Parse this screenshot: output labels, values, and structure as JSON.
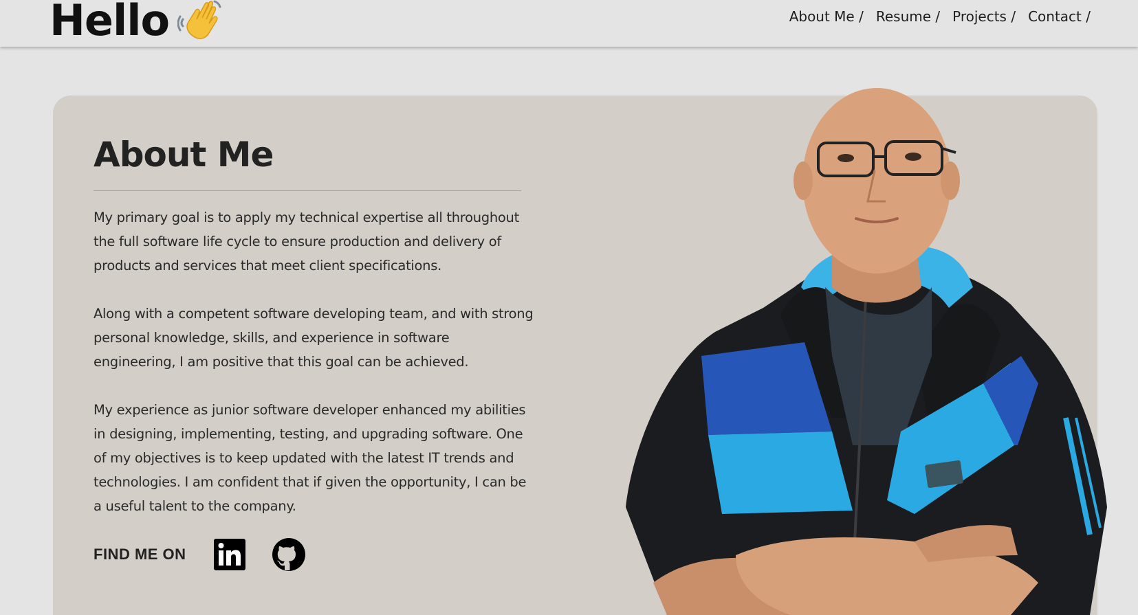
{
  "header": {
    "brand": "Hello",
    "wave_icon": "waving-hand-icon",
    "nav": [
      {
        "label": "About Me /"
      },
      {
        "label": "Resume /"
      },
      {
        "label": "Projects /"
      },
      {
        "label": "Contact /"
      }
    ]
  },
  "about": {
    "title": "About Me",
    "paragraphs": [
      "My primary goal is to apply my technical expertise all throughout the full software life cycle to ensure production and delivery of products and services that meet client specifications.",
      "Along with a competent software developing team, and with strong personal knowledge, skills, and experience in software engineering, I am positive that this goal can be achieved.",
      "My experience as junior software developer enhanced my abilities in designing, implementing, testing, and upgrading software. One of my objectives is to keep updated with the latest IT trends and technologies. I am confident that if given the opportunity, I can be a useful talent to the company."
    ],
    "find_me_label": "FIND ME ON",
    "social_icons": [
      "linkedin-icon",
      "github-icon"
    ]
  },
  "colors": {
    "page_bg": "#e4e4e4",
    "card_bg": "#d3cec8",
    "text": "#222222"
  }
}
